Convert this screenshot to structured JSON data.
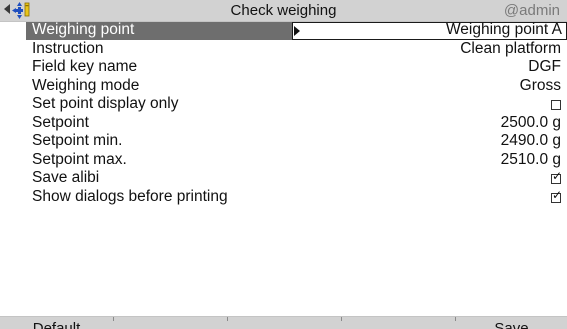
{
  "header": {
    "title": "Check weighing",
    "user": "@admin",
    "icons": [
      "back-arrow-icon",
      "scale-navigation-icon"
    ]
  },
  "rows": [
    {
      "label": "Weighing point",
      "value": "Weighing point A",
      "selected": true
    },
    {
      "label": "Instruction",
      "value": "Clean platform"
    },
    {
      "label": "Field key name",
      "value": "DGF"
    },
    {
      "label": "Weighing mode",
      "value": "Gross"
    },
    {
      "label": "Set point display only",
      "checkbox": true,
      "checked": false
    },
    {
      "label": "Setpoint",
      "value": "2500.0 g"
    },
    {
      "label": "Setpoint min.",
      "value": "2490.0 g"
    },
    {
      "label": "Setpoint max.",
      "value": "2510.0 g"
    },
    {
      "label": "Save alibi",
      "checkbox": true,
      "checked": true
    },
    {
      "label": "Show dialogs before printing",
      "checkbox": true,
      "checked": true
    }
  ],
  "softkeys": [
    "Default",
    "",
    "",
    "",
    "Save"
  ],
  "colors": {
    "bar_bg": "#d2d2d2",
    "selected_bg": "#6e6e6e",
    "user_text": "#7a7a7a",
    "icon_blue": "#1f4fbf",
    "icon_yellow": "#e8c51a"
  }
}
